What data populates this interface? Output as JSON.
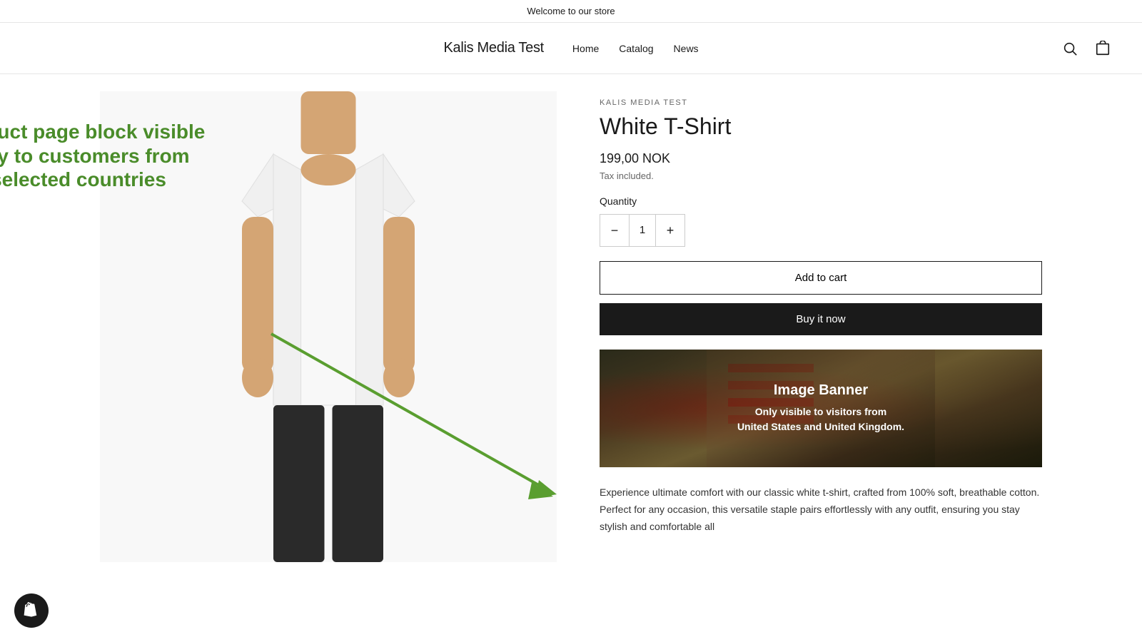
{
  "announcement": {
    "text": "Welcome to our store"
  },
  "header": {
    "store_name": "Kalis Media Test",
    "nav": [
      {
        "label": "Home",
        "href": "#"
      },
      {
        "label": "Catalog",
        "href": "#"
      },
      {
        "label": "News",
        "href": "#"
      }
    ],
    "search_label": "Search",
    "cart_label": "Cart"
  },
  "annotation": {
    "text": "Product page block visible only to customers from selected countries"
  },
  "product": {
    "brand": "KALIS MEDIA TEST",
    "title": "White T-Shirt",
    "price": "199,00 NOK",
    "tax_note": "Tax included.",
    "quantity_label": "Quantity",
    "quantity_value": "1",
    "add_to_cart_label": "Add to cart",
    "buy_now_label": "Buy it now"
  },
  "banner": {
    "title": "Image Banner",
    "subtitle": "Only visible to visitors from\nUnited States and United Kingdom."
  },
  "description": {
    "text": "Experience ultimate comfort with our classic white t-shirt, crafted from 100% soft, breathable cotton. Perfect for any occasion, this versatile staple pairs effortlessly with any outfit, ensuring you stay stylish and comfortable all"
  }
}
